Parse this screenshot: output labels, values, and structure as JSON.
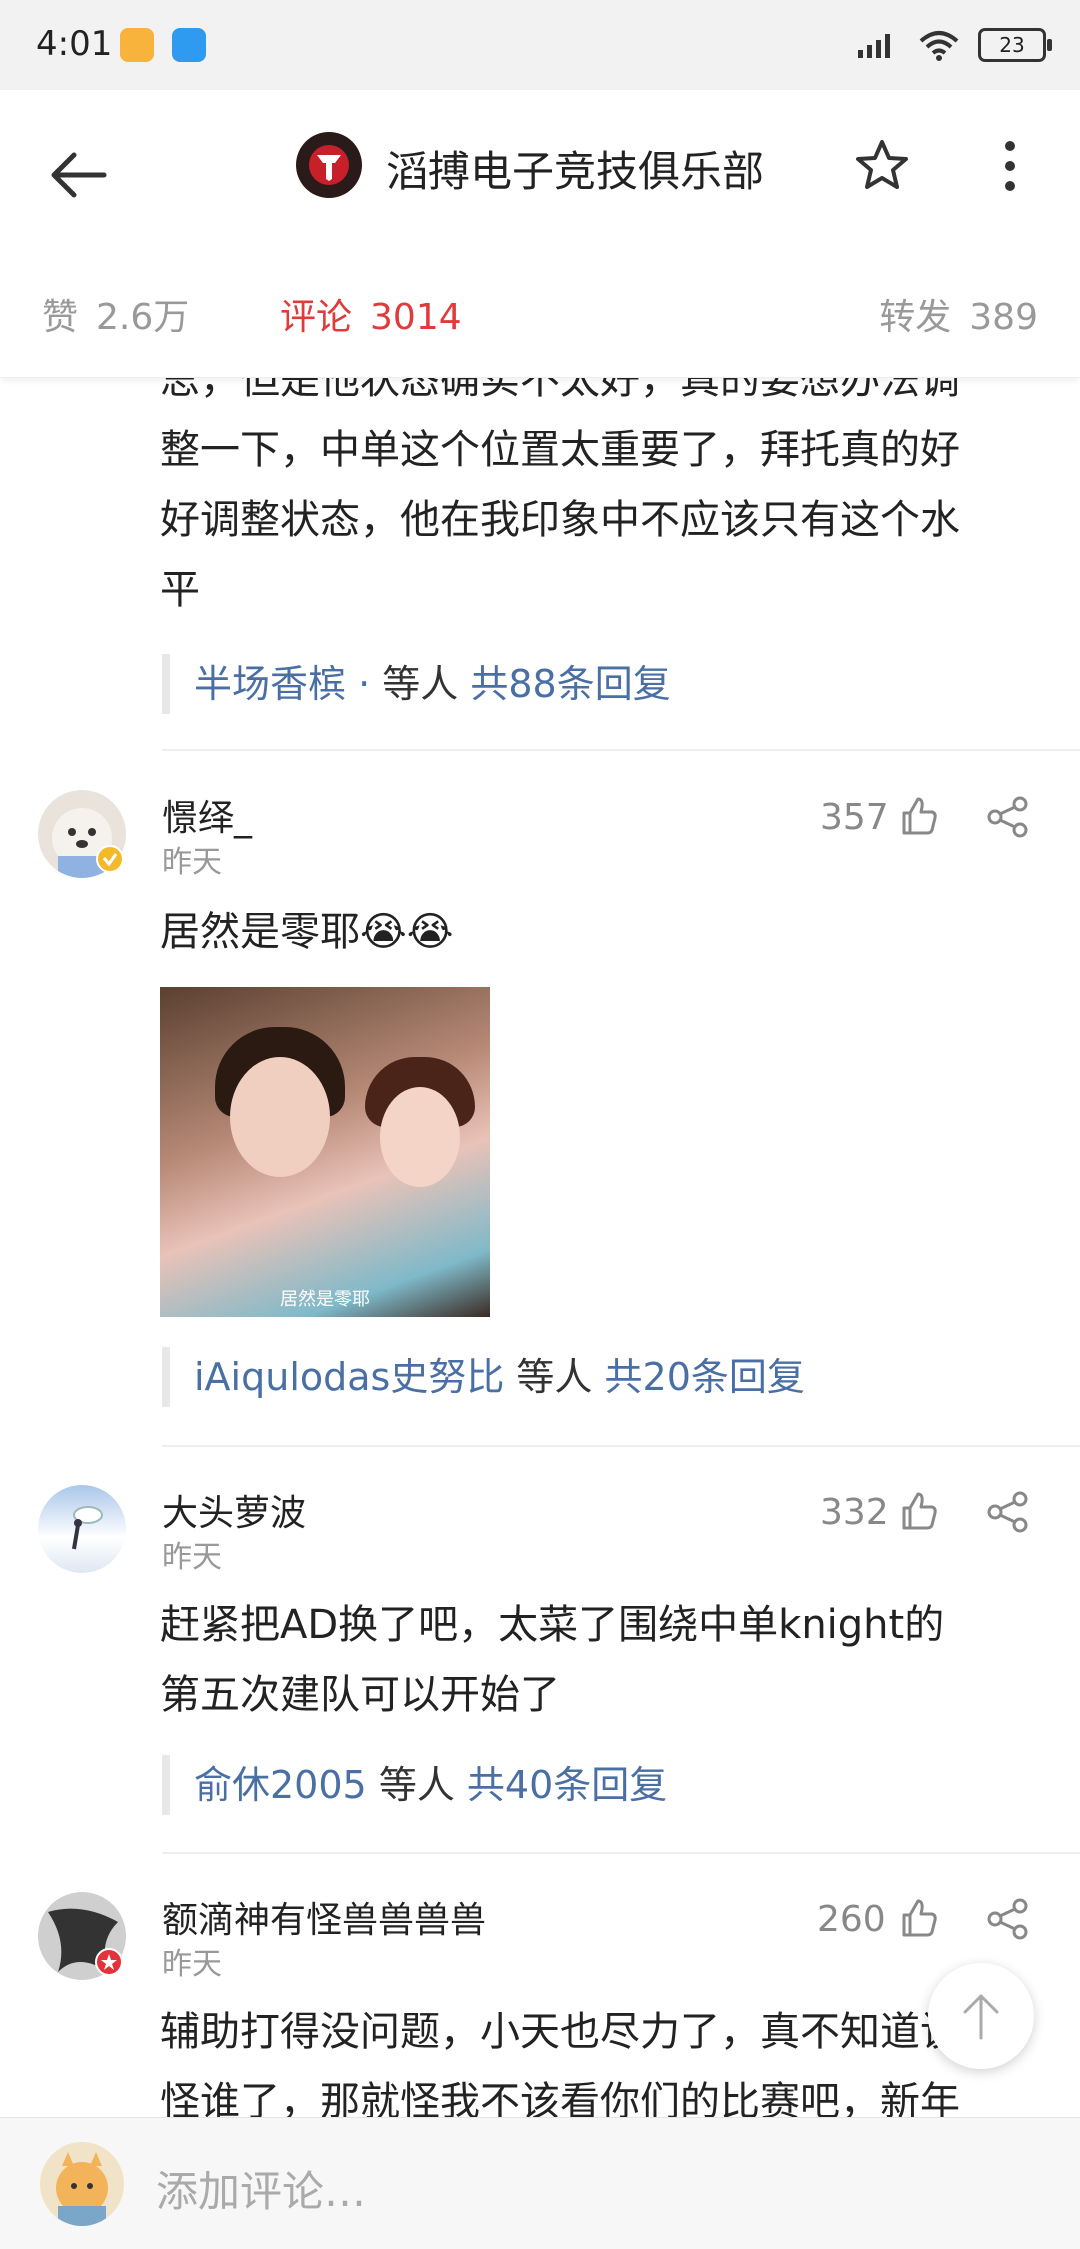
{
  "status_bar": {
    "time": "4:01",
    "battery": "23"
  },
  "header": {
    "title": "滔搏电子竞技俱乐部",
    "stats": {
      "like_label": "赞",
      "like_count": "2.6万",
      "comment_label": "评论",
      "comment_count": "3014",
      "forward_label": "转发",
      "forward_count": "389"
    }
  },
  "comments": [
    {
      "text_lines": [
        "思，但是他状态确实不太好，真的要想办法调",
        "整一下，中单这个位置太重要了，拜托真的好",
        "好调整状态，他在我印象中不应该只有这个水",
        "平"
      ],
      "reply": {
        "users": "半场香槟 · ",
        "mid": "等人",
        "count": "共88条回复"
      }
    },
    {
      "user": "憬绎_",
      "time": "昨天",
      "likes": "357",
      "text": "居然是零耶😭😭",
      "image_caption": "居然是零耶",
      "reply": {
        "users": "iAiqulodas史努比",
        "mid": "等人",
        "count": "共20条回复"
      }
    },
    {
      "user": "大头萝波",
      "time": "昨天",
      "likes": "332",
      "text_lines": [
        "赶紧把AD换了吧，太菜了围绕中单knight的",
        "第五次建队可以开始了"
      ],
      "reply": {
        "users": "俞休2005",
        "mid": "等人",
        "count": "共40条回复"
      }
    },
    {
      "user": "额滴神有怪兽兽兽兽",
      "time": "昨天",
      "likes": "260",
      "text_lines": [
        "辅助打得没问题，小天也尽力了，真不知道该",
        "怪谁了，那就怪我不该看你们的比赛吧，新年"
      ]
    }
  ],
  "input": {
    "placeholder": "添加评论…"
  }
}
